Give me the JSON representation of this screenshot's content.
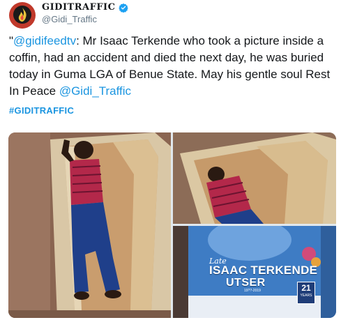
{
  "tweet": {
    "display_name": "GIDITRAFFIC",
    "handle": "@Gidi_Traffic",
    "text_open_quote": "\"",
    "text_mention_1": "@gidifeedtv",
    "text_body": ": Mr Isaac Terkende who took a picture inside a coffin, had an accident and died the next day, he was buried today in Guma LGA of Benue State. May his gentle soul Rest In Peace  ",
    "text_mention_2": "@Gidi_Traffic",
    "hashtag": "#GIDITRAFFIC"
  },
  "photos": {
    "poster": {
      "late": "Late",
      "name_line1": "ISAAC TERKENDE",
      "name_line2": "UTSER",
      "years": "19??-2019",
      "age_number": "21",
      "age_label": "YEARS"
    }
  },
  "colors": {
    "link": "#1b95e0",
    "secondary_text": "#657786",
    "verified": "#1da1f2",
    "avatar_bg": "#c0392b"
  },
  "icons": {
    "avatar": "flame-logo-icon",
    "verified": "verified-badge-icon"
  }
}
